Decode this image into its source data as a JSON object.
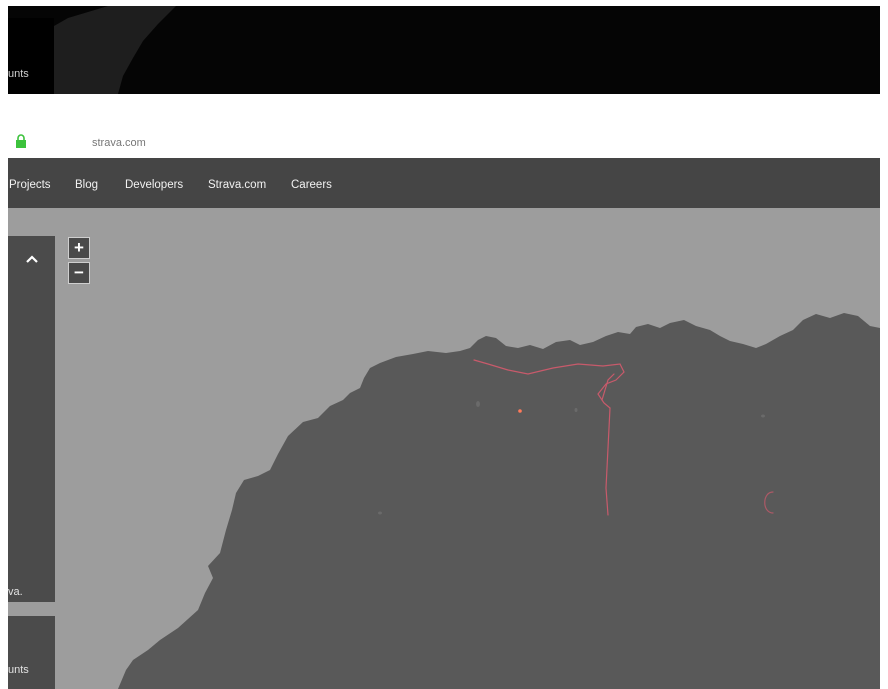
{
  "top_strip": {
    "panel_text": "unts"
  },
  "browser": {
    "url": "strava.com"
  },
  "nav": {
    "items": [
      "Projects",
      "Blog",
      "Developers",
      "Strava.com",
      "Careers"
    ]
  },
  "map": {
    "zoom_in_label": "+",
    "zoom_out_label": "−",
    "side_panel_text": "va.",
    "side_panel2_text": "unts"
  },
  "colors": {
    "land": "#595959",
    "water": "#9d9d9d",
    "nav_bg": "#454545",
    "track": "#c85a6b",
    "lock": "#3cc23c"
  },
  "icons": {
    "lock": "lock-icon",
    "collapse": "chevron-up-icon"
  }
}
